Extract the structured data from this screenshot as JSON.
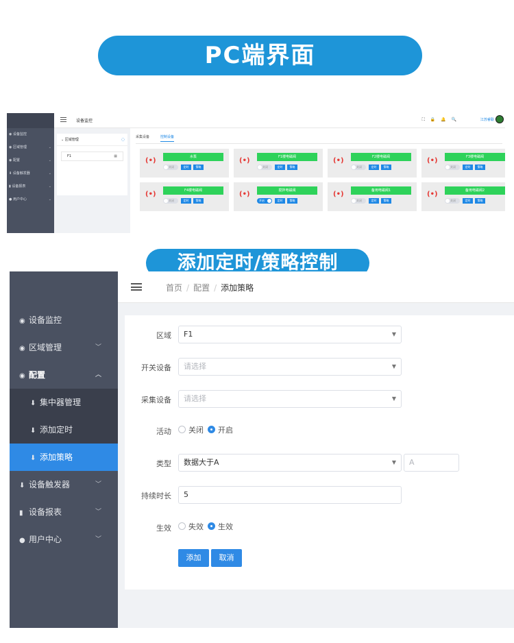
{
  "banner1": "PC端界面",
  "banner2": "添加定时/策略控制",
  "mini": {
    "breadcrumb": "设备监控",
    "tools": "⛶ 🔒 🔔 🔍",
    "user": "江苏睿联 ▾",
    "sidebar": [
      "设备监控",
      "区域管理",
      "配置",
      "设备触发器",
      "设备报表",
      "用户中心"
    ],
    "tree_title": "区域管理",
    "tree_node": "F1",
    "tabs": [
      "采集设备",
      "控制设备"
    ],
    "devices": [
      {
        "name": "水泵",
        "toggle": "关闭",
        "on": false
      },
      {
        "name": "F1楼电磁阀",
        "toggle": "关闭",
        "on": false
      },
      {
        "name": "F2楼电磁阀",
        "toggle": "关闭",
        "on": false
      },
      {
        "name": "F3楼电磁阀",
        "toggle": "关闭",
        "on": false
      },
      {
        "name": "F4楼电磁阀",
        "toggle": "关闭",
        "on": false
      },
      {
        "name": "搅拌电磁阀",
        "toggle": "开启",
        "on": true
      },
      {
        "name": "备用电磁阀1",
        "toggle": "关闭",
        "on": false
      },
      {
        "name": "备用电磁阀2",
        "toggle": "关闭",
        "on": false
      }
    ],
    "btn_timer": "定时",
    "btn_policy": "策略"
  },
  "sidebar": {
    "items": [
      {
        "label": "设备监控",
        "icon": "◉"
      },
      {
        "label": "区域管理",
        "icon": "◉"
      },
      {
        "label": "配置",
        "icon": "◉"
      },
      {
        "label": "集中器管理",
        "icon": "⬇"
      },
      {
        "label": "添加定时",
        "icon": "⬇"
      },
      {
        "label": "添加策略",
        "icon": "⬇"
      },
      {
        "label": "设备触发器",
        "icon": "⬇"
      },
      {
        "label": "设备报表",
        "icon": "▮"
      },
      {
        "label": "用户中心",
        "icon": "●"
      }
    ]
  },
  "breadcrumb": {
    "home": "首页",
    "config": "配置",
    "current": "添加策略"
  },
  "form": {
    "area_label": "区域",
    "area_value": "F1",
    "switch_label": "开关设备",
    "switch_placeholder": "请选择",
    "collect_label": "采集设备",
    "collect_placeholder": "请选择",
    "active_label": "活动",
    "active_off": "关闭",
    "active_on": "开启",
    "type_label": "类型",
    "type_value": "数据大于A",
    "type_param_placeholder": "A",
    "duration_label": "持续时长",
    "duration_value": "5",
    "effect_label": "生效",
    "effect_off": "失效",
    "effect_on": "生效",
    "add_btn": "添加",
    "cancel_btn": "取消"
  }
}
